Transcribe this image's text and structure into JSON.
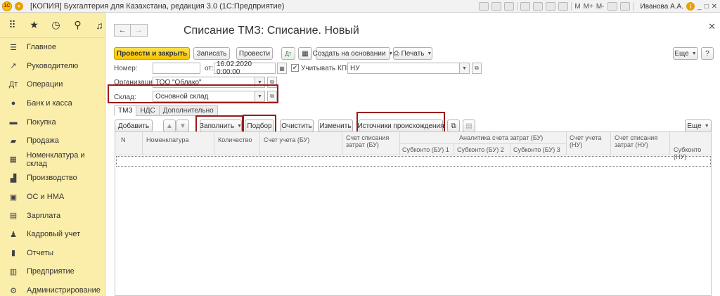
{
  "window": {
    "title": "[КОПИЯ] Бухгалтерия для Казахстана, редакция 3.0  (1С:Предприятие)",
    "tools": [
      "M",
      "M+",
      "M-"
    ],
    "user": "Иванова А.А."
  },
  "sidebar": {
    "top_icons": [
      "apps-grid-icon",
      "star-icon",
      "history-icon",
      "search-icon",
      "bell-icon"
    ],
    "items": [
      {
        "label": "Главное",
        "icon": "menu-icon"
      },
      {
        "label": "Руководителю",
        "icon": "trend-icon"
      },
      {
        "label": "Операции",
        "icon": "debit-credit-icon"
      },
      {
        "label": "Банк и касса",
        "icon": "coin-icon"
      },
      {
        "label": "Покупка",
        "icon": "cart-icon"
      },
      {
        "label": "Продажа",
        "icon": "basket-icon"
      },
      {
        "label": "Номенклатура и склад",
        "icon": "warehouse-icon"
      },
      {
        "label": "Производство",
        "icon": "factory-icon"
      },
      {
        "label": "ОС и НМА",
        "icon": "assets-icon"
      },
      {
        "label": "Зарплата",
        "icon": "wallet-icon"
      },
      {
        "label": "Кадровый учет",
        "icon": "people-icon"
      },
      {
        "label": "Отчеты",
        "icon": "bar-chart-icon"
      },
      {
        "label": "Предприятие",
        "icon": "building-icon"
      },
      {
        "label": "Администрирование",
        "icon": "gear-icon"
      }
    ]
  },
  "document": {
    "title": "Списание ТМЗ: Списание. Новый",
    "toolbar": {
      "post_close": "Провести и закрыть",
      "save": "Записать",
      "post": "Провести",
      "create_based": "Создать на основании",
      "print": "Печать",
      "more": "Еще",
      "help": "?"
    },
    "fields": {
      "number_label": "Номер:",
      "number_value": "",
      "date_label": "от:",
      "date_value": "16.02.2020  0:00:00",
      "kpn_label": "Учитывать КПН",
      "kpn_value": "НУ",
      "org_label": "Организация:",
      "org_value": "ТОО \"Облако\"",
      "warehouse_label": "Склад:",
      "warehouse_value": "Основной склад"
    },
    "tabs": [
      "ТМЗ",
      "НДС",
      "Дополнительно"
    ],
    "table_toolbar": {
      "add": "Добавить",
      "fill": "Заполнить",
      "pick": "Подбор",
      "clear": "Очистить",
      "change": "Изменить",
      "sources": "Источники происхождения",
      "more": "Еще"
    },
    "columns": {
      "n": "N",
      "item": "Номенклатура",
      "qty": "Количество",
      "acct_bu": "Счет учета (БУ)",
      "cost_acct_bu_1": "Счет списания",
      "cost_acct_bu_2": "затрат (БУ)",
      "analytics_group": "Аналитика счета затрат (БУ)",
      "sub1": "Субконто (БУ) 1",
      "sub2": "Субконто (БУ) 2",
      "sub3": "Субконто (БУ) 3",
      "acct_nu_1": "Счет учета",
      "acct_nu_2": "(НУ)",
      "cost_acct_nu_1": "Счет списания",
      "cost_acct_nu_2": "затрат (НУ)",
      "sub_nu": "Субконто (НУ)"
    }
  }
}
